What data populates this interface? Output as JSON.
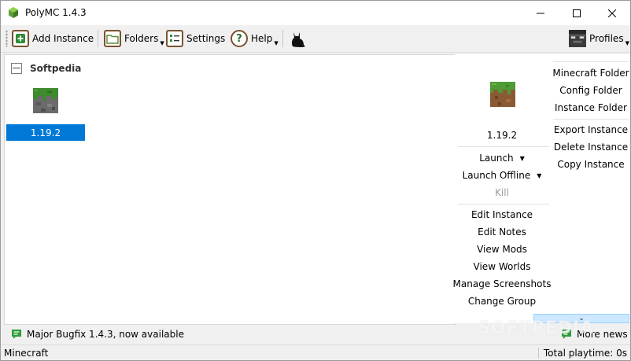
{
  "window": {
    "title": "PolyMC 1.4.3"
  },
  "toolbar": {
    "add_instance": "Add Instance",
    "folders": "Folders",
    "settings": "Settings",
    "help": "Help",
    "profiles": "Profiles"
  },
  "instances": {
    "group": "Softpedia",
    "items": [
      {
        "name": "1.19.2",
        "selected": true
      }
    ]
  },
  "panel": {
    "instance_name": "1.19.2",
    "launch": "Launch",
    "launch_offline": "Launch Offline",
    "kill": "Kill",
    "edit_instance": "Edit Instance",
    "edit_notes": "Edit Notes",
    "view_mods": "View Mods",
    "view_worlds": "View Worlds",
    "manage_screenshots": "Manage Screenshots",
    "change_group": "Change Group",
    "minecraft_folder": "Minecraft Folder",
    "config_folder": "Config Folder",
    "instance_folder": "Instance Folder",
    "export_instance": "Export Instance",
    "delete_instance": "Delete Instance",
    "copy_instance": "Copy Instance"
  },
  "news": {
    "headline": "Major Bugfix 1.4.3, now available",
    "more": "More news"
  },
  "status": {
    "left": "Minecraft",
    "playtime": "Total playtime: 0s"
  },
  "watermark": "SOFTPEDIA",
  "colors": {
    "selection": "#0078d7",
    "add_green": "#2e8b3a",
    "accent": "#7a5230"
  },
  "icons": [
    "polymc-logo-icon",
    "minimize-icon",
    "maximize-icon",
    "close-icon",
    "add-instance-icon",
    "folder-icon",
    "settings-icon",
    "help-icon",
    "cat-icon",
    "profile-avatar-icon",
    "grass-block-icon",
    "news-icon",
    "expand-icon"
  ]
}
